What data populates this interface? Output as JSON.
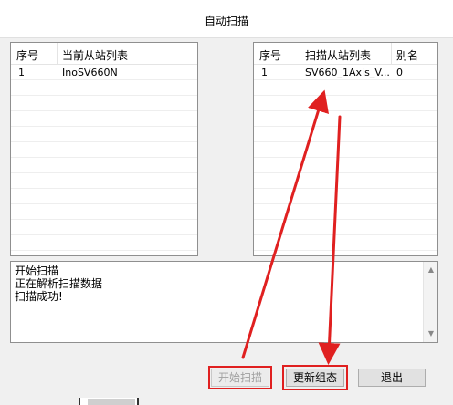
{
  "window": {
    "title": "自动扫描"
  },
  "left_table": {
    "headers": [
      "序号",
      "当前从站列表"
    ],
    "rows": [
      {
        "index": "1",
        "name": "InoSV660N"
      }
    ]
  },
  "right_table": {
    "headers": [
      "序号",
      "扫描从站列表",
      "别名"
    ],
    "rows": [
      {
        "index": "1",
        "name": "SV660_1Axis_V...",
        "alias": "0"
      }
    ]
  },
  "log": {
    "lines": [
      "开始扫描",
      "正在解析扫描数据",
      "扫描成功!"
    ]
  },
  "buttons": {
    "start": "开始扫描",
    "update": "更新组态",
    "exit": "退出"
  },
  "colors": {
    "annotation": "#e02020"
  }
}
